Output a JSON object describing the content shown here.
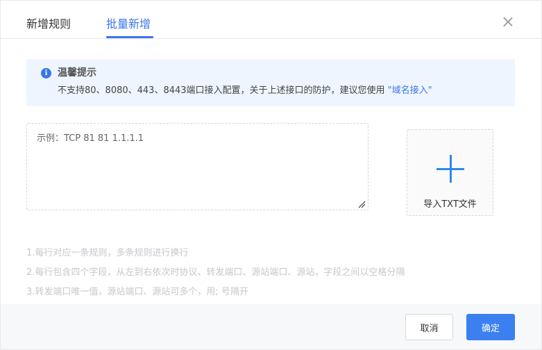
{
  "tabs": [
    {
      "label": "新增规则",
      "active": false
    },
    {
      "label": "批量新增",
      "active": true
    }
  ],
  "alert": {
    "title": "温馨提示",
    "text": "不支持80、8080、443、8443端口接入配置，关于上述接口的防护，建议您使用",
    "link": "\"域名接入\""
  },
  "input": {
    "placeholder": "示例：TCP 81 81 1.1.1.1",
    "value": ""
  },
  "upload": {
    "label": "导入TXT文件"
  },
  "notes": [
    "1.每行对应一条规则，多条规则进行换行",
    "2.每行包含四个字段，从左到右依次时协议、转发端口、源站端口、源站，字段之间以空格分隔",
    "3.转发端口唯一值，源站端口、源站可多个，用; 号隔开"
  ],
  "footer": {
    "cancel_label": "取消",
    "ok_label": "确定"
  },
  "colors": {
    "accent": "#3a76e8",
    "alert_bg": "#eef5fe",
    "primary_button": "#3b7ff0"
  },
  "icons": {
    "info": "info-icon",
    "close": "close-icon",
    "upload": "plus-icon"
  }
}
